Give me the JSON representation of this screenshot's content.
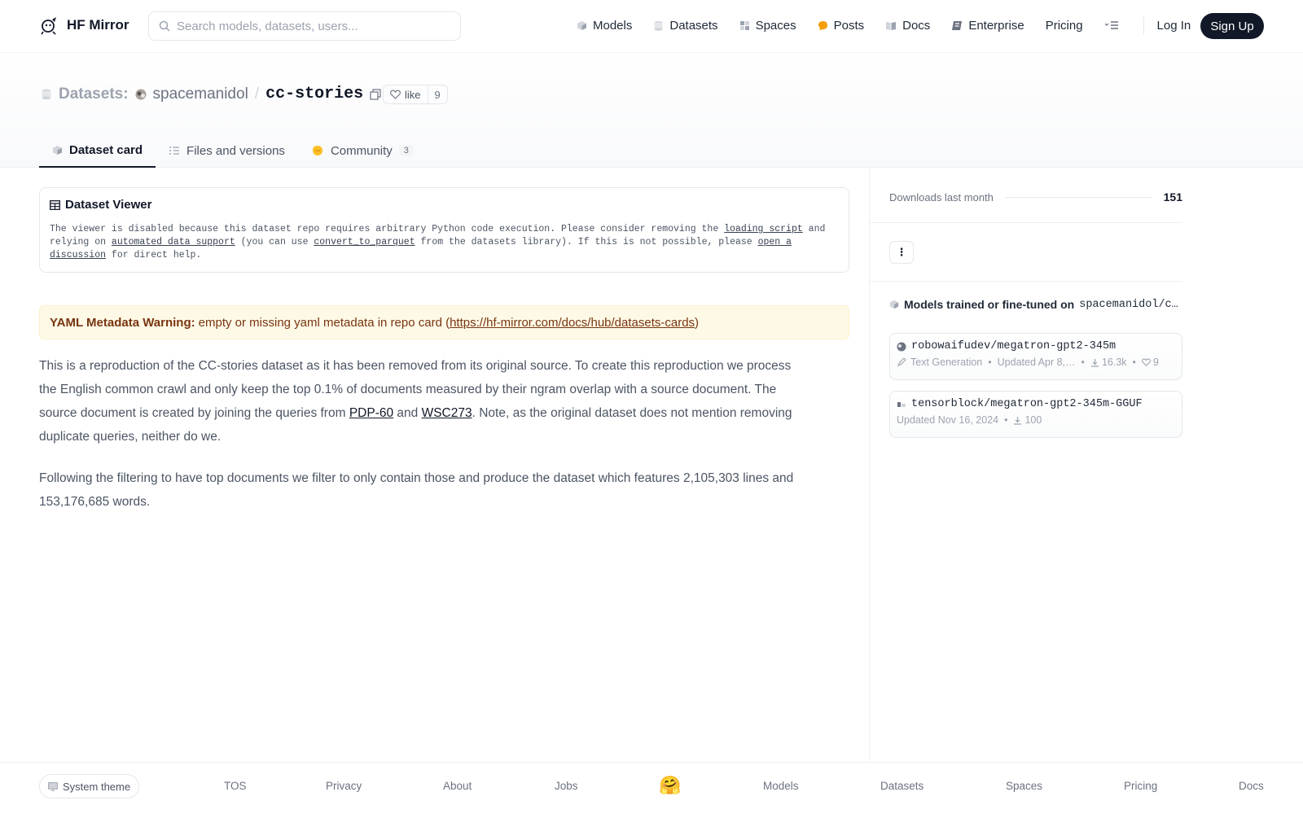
{
  "header": {
    "brand": "HF Mirror",
    "search_placeholder": "Search models, datasets, users...",
    "nav": [
      {
        "label": "Models",
        "icon": "models-icon"
      },
      {
        "label": "Datasets",
        "icon": "datasets-icon"
      },
      {
        "label": "Spaces",
        "icon": "spaces-icon"
      },
      {
        "label": "Posts",
        "icon": "posts-icon"
      },
      {
        "label": "Docs",
        "icon": "docs-icon"
      },
      {
        "label": "Enterprise",
        "icon": "enterprise-icon"
      },
      {
        "label": "Pricing"
      }
    ],
    "login": "Log In",
    "signup": "Sign Up"
  },
  "repo": {
    "prefix": "Datasets:",
    "owner": "spacemanidol",
    "slash": "/",
    "name": "cc-stories",
    "like_label": "like",
    "like_count": "9"
  },
  "tabs": [
    {
      "label": "Dataset card"
    },
    {
      "label": "Files and versions"
    },
    {
      "label": "Community",
      "badge": "3"
    }
  ],
  "viewer": {
    "title": "Dataset Viewer",
    "t1": "The viewer is disabled because this dataset repo requires arbitrary Python code execution. Please consider removing the ",
    "link1": "loading script",
    "t2": " and relying on ",
    "link2": "automated data support",
    "t3": " (you can use ",
    "link3": "convert_to_parquet",
    "t4": " from the datasets library). If this is not possible, please ",
    "link4": "open a discussion",
    "t5": " for direct help."
  },
  "warning": {
    "label": "YAML Metadata Warning:",
    "text": "empty or missing yaml metadata in repo card (",
    "link": "https://hf-mirror.com/docs/hub/datasets-cards",
    "close": ")"
  },
  "body": {
    "p1a": "This is a reproduction of the CC-stories dataset as it has been removed from its original source. To create this reproduction we process the English common crawl and only keep the top 0.1% of documents measured by their ngram overlap with a source document. The source document is created by joining the queries from ",
    "p1_link1": "PDP-60",
    "p1_and": " and ",
    "p1_link2": "WSC273",
    "p1b": ". Note, as the original dataset does not mention removing duplicate queries, neither do we.",
    "p2": "Following the filtering to have top documents we filter to only contain those and produce the dataset which features 2,105,303 lines and 153,176,685 words."
  },
  "sidebar": {
    "downloads_label": "Downloads last month",
    "downloads_value": "151",
    "menu_glyph": "⋮",
    "models_title": "Models trained or fine-tuned on",
    "models_repo": "spacemanidol/c…",
    "models": [
      {
        "name": "robowaifudev/megatron-gpt2-345m",
        "task": "Text Generation",
        "updated": "Updated Apr 8,…",
        "downloads": "16.3k",
        "likes": "9"
      },
      {
        "name": "tensorblock/megatron-gpt2-345m-GGUF",
        "updated": "Updated Nov 16, 2024",
        "downloads": "100"
      }
    ]
  },
  "footer": {
    "theme": "System theme",
    "links": [
      "TOS",
      "Privacy",
      "About",
      "Jobs",
      "Models",
      "Datasets",
      "Spaces",
      "Pricing",
      "Docs"
    ],
    "emoji": "🤗"
  },
  "colors": {
    "accent_dark": "#111827",
    "warning_bg": "#fef9e7",
    "warning_text": "#78350f"
  }
}
